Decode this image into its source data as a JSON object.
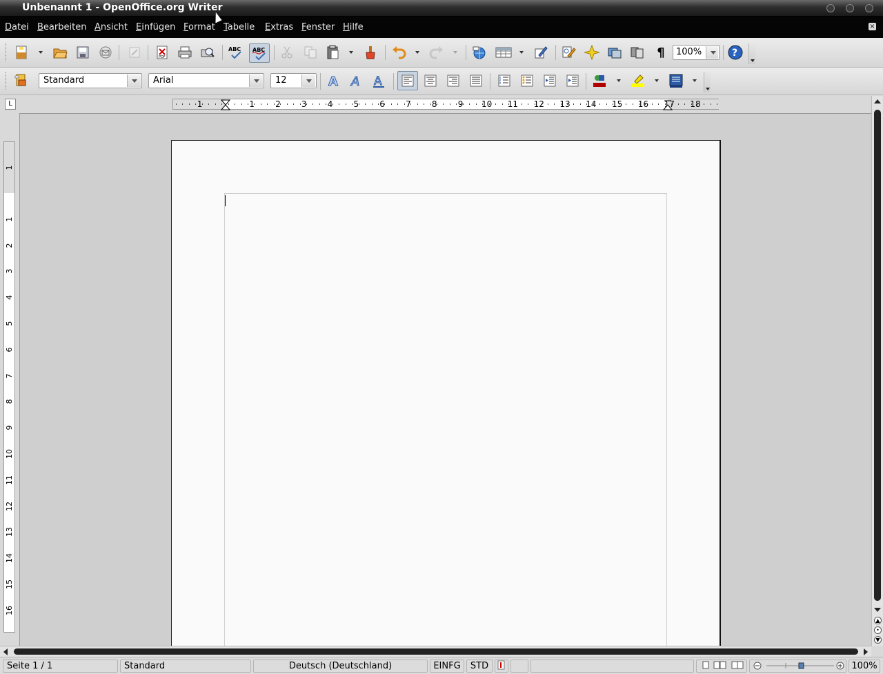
{
  "window": {
    "title": "Unbenannt 1 - OpenOffice.org Writer"
  },
  "menu": [
    "Datei",
    "Bearbeiten",
    "Ansicht",
    "Einfügen",
    "Format",
    "Tabelle",
    "Extras",
    "Fenster",
    "Hilfe"
  ],
  "toolbar_standard": {
    "zoom_value": "100%",
    "icons": [
      "new-document-icon",
      "open-folder-icon",
      "save-icon",
      "email-icon",
      "edit-file-icon",
      "export-pdf-icon",
      "print-icon",
      "print-preview-icon",
      "spellcheck-icon",
      "autospellcheck-icon",
      "cut-icon",
      "copy-icon",
      "paste-icon",
      "clone-formatting-icon",
      "undo-icon",
      "redo-icon",
      "hyperlink-icon",
      "table-icon",
      "show-draw-functions-icon",
      "find-replace-icon",
      "navigator-icon",
      "gallery-icon",
      "data-sources-icon",
      "formatting-marks-icon",
      "help-icon"
    ]
  },
  "toolbar_formatting": {
    "paragraph_style": "Standard",
    "font_name": "Arial",
    "font_size": "12",
    "icons": [
      "styles-formatting-icon",
      "bold-icon",
      "italic-icon",
      "underline-icon",
      "align-left-icon",
      "align-center-icon",
      "align-right-icon",
      "justify-icon",
      "numbering-icon",
      "bullets-icon",
      "decrease-indent-icon",
      "increase-indent-icon",
      "font-color-icon",
      "highlighting-icon",
      "background-color-icon"
    ]
  },
  "ruler": {
    "tab_type_symbol": "L",
    "h_labels": [
      "1",
      "1",
      "2",
      "3",
      "4",
      "5",
      "6",
      "7",
      "8",
      "9",
      "10",
      "11",
      "12",
      "13",
      "14",
      "15",
      "16",
      "17",
      "18"
    ],
    "v_labels": [
      "1",
      "1",
      "2",
      "3",
      "4",
      "5",
      "6",
      "7",
      "8",
      "9",
      "10",
      "11",
      "12",
      "13",
      "14",
      "15",
      "16"
    ]
  },
  "statusbar": {
    "page": "Seite 1 / 1",
    "style": "Standard",
    "language": "Deutsch (Deutschland)",
    "insert_mode": "EINFG",
    "selection_mode": "STD",
    "zoom": "100%"
  },
  "colors": {
    "font_color": "#b00000",
    "highlight_color": "#ffff00",
    "menubar_bg": "#050505"
  }
}
